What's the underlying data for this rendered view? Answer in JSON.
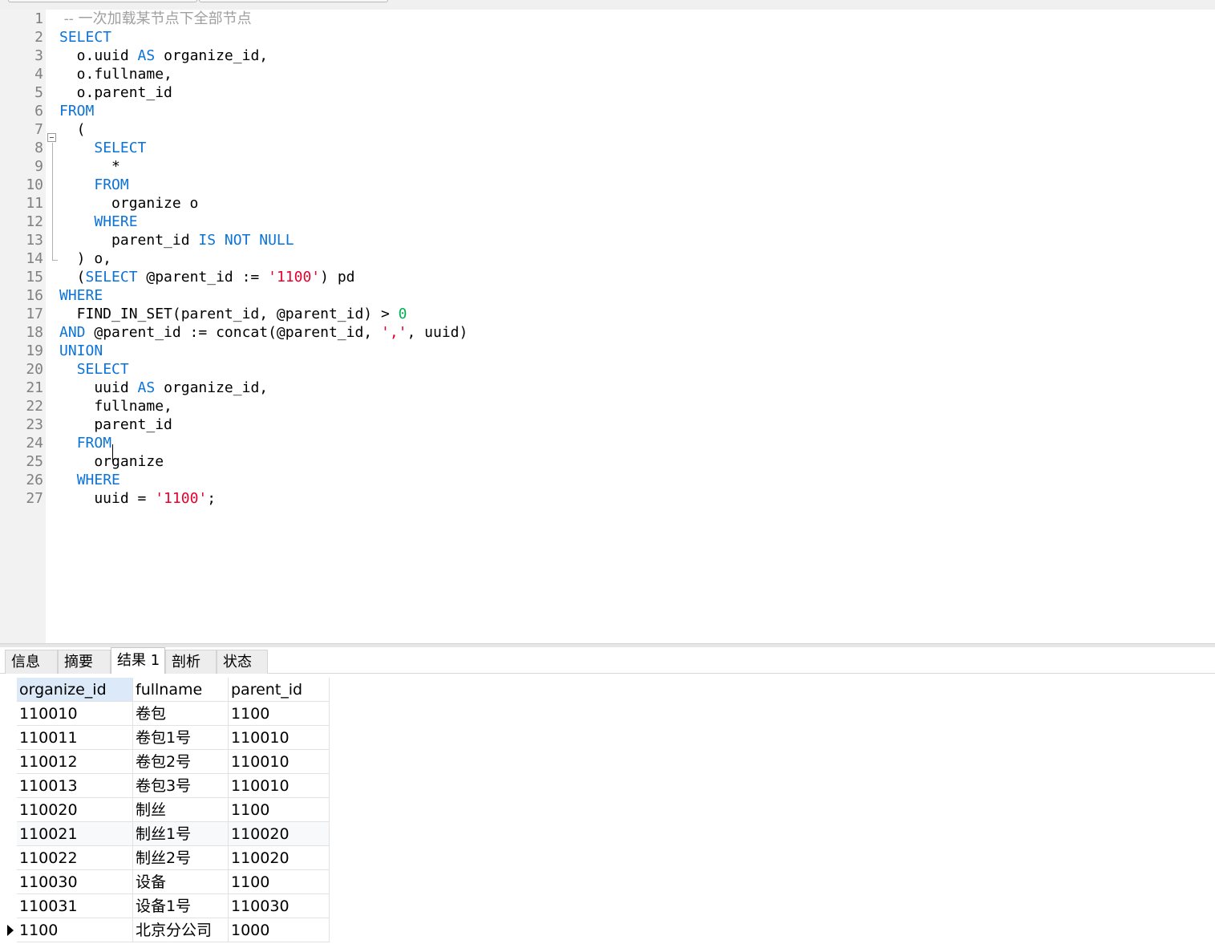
{
  "editor": {
    "lines": [
      [
        {
          "t": " -- ",
          "c": "comment"
        },
        {
          "t": "一次加载某节点下全部节点",
          "c": "comment"
        }
      ],
      [
        {
          "t": "SELECT",
          "c": "kw"
        }
      ],
      [
        {
          "t": "  o.uuid ",
          "c": "plain"
        },
        {
          "t": "AS",
          "c": "kw"
        },
        {
          "t": " organize_id,",
          "c": "plain"
        }
      ],
      [
        {
          "t": "  o.fullname,",
          "c": "plain"
        }
      ],
      [
        {
          "t": "  o.parent_id",
          "c": "plain"
        }
      ],
      [
        {
          "t": "FROM",
          "c": "kw"
        }
      ],
      [
        {
          "t": "  (",
          "c": "plain"
        }
      ],
      [
        {
          "t": "    ",
          "c": "plain"
        },
        {
          "t": "SELECT",
          "c": "kw"
        }
      ],
      [
        {
          "t": "      *",
          "c": "plain"
        }
      ],
      [
        {
          "t": "    ",
          "c": "plain"
        },
        {
          "t": "FROM",
          "c": "kw"
        }
      ],
      [
        {
          "t": "      organize o",
          "c": "plain"
        }
      ],
      [
        {
          "t": "    ",
          "c": "plain"
        },
        {
          "t": "WHERE",
          "c": "kw"
        }
      ],
      [
        {
          "t": "      parent_id ",
          "c": "plain"
        },
        {
          "t": "IS NOT NULL",
          "c": "kw"
        }
      ],
      [
        {
          "t": "  ) o,",
          "c": "plain"
        }
      ],
      [
        {
          "t": "  (",
          "c": "plain"
        },
        {
          "t": "SELECT",
          "c": "kw"
        },
        {
          "t": " @parent_id := ",
          "c": "plain"
        },
        {
          "t": "'1100'",
          "c": "str"
        },
        {
          "t": ") pd",
          "c": "plain"
        }
      ],
      [
        {
          "t": "WHERE",
          "c": "kw"
        }
      ],
      [
        {
          "t": "  FIND_IN_SET(parent_id, @parent_id) > ",
          "c": "plain"
        },
        {
          "t": "0",
          "c": "num"
        }
      ],
      [
        {
          "t": "AND",
          "c": "kw"
        },
        {
          "t": " @parent_id := concat(@parent_id, ",
          "c": "plain"
        },
        {
          "t": "','",
          "c": "str"
        },
        {
          "t": ", uuid)",
          "c": "plain"
        }
      ],
      [
        {
          "t": "UNION",
          "c": "kw"
        }
      ],
      [
        {
          "t": "  ",
          "c": "plain"
        },
        {
          "t": "SELECT",
          "c": "kw"
        }
      ],
      [
        {
          "t": "    uuid ",
          "c": "plain"
        },
        {
          "t": "AS",
          "c": "kw"
        },
        {
          "t": " organize_id,",
          "c": "plain"
        }
      ],
      [
        {
          "t": "    fullname,",
          "c": "plain"
        }
      ],
      [
        {
          "t": "    parent_id",
          "c": "plain"
        }
      ],
      [
        {
          "t": "  ",
          "c": "plain"
        },
        {
          "t": "FROM",
          "c": "kw"
        }
      ],
      [
        {
          "t": "    organize",
          "c": "plain"
        }
      ],
      [
        {
          "t": "  ",
          "c": "plain"
        },
        {
          "t": "WHERE",
          "c": "kw"
        }
      ],
      [
        {
          "t": "    uuid = ",
          "c": "plain"
        },
        {
          "t": "'1100'",
          "c": "str"
        },
        {
          "t": ";",
          "c": "plain"
        }
      ]
    ]
  },
  "result_tabs": [
    {
      "label": "信息",
      "active": false
    },
    {
      "label": "摘要",
      "active": false
    },
    {
      "label": "结果 1",
      "active": true
    },
    {
      "label": "剖析",
      "active": false
    },
    {
      "label": "状态",
      "active": false
    }
  ],
  "grid": {
    "columns": [
      "organize_id",
      "fullname",
      "parent_id"
    ],
    "rows": [
      [
        "110010",
        "卷包",
        "1100"
      ],
      [
        "110011",
        "卷包1号",
        "110010"
      ],
      [
        "110012",
        "卷包2号",
        "110010"
      ],
      [
        "110013",
        "卷包3号",
        "110010"
      ],
      [
        "110020",
        "制丝",
        "1100"
      ],
      [
        "110021",
        "制丝1号",
        "110020"
      ],
      [
        "110022",
        "制丝2号",
        "110020"
      ],
      [
        "110030",
        "设备",
        "1100"
      ],
      [
        "110031",
        "设备1号",
        "110030"
      ],
      [
        "1100",
        "北京分公司",
        "1000"
      ]
    ],
    "current_row_index": 9,
    "highlighted_row_index": 5
  },
  "colors": {
    "keyword": "#0b73d8",
    "string": "#e8002d",
    "number": "#00b050",
    "comment": "#a0a0a0",
    "header_selected": "#dbe9f8"
  }
}
